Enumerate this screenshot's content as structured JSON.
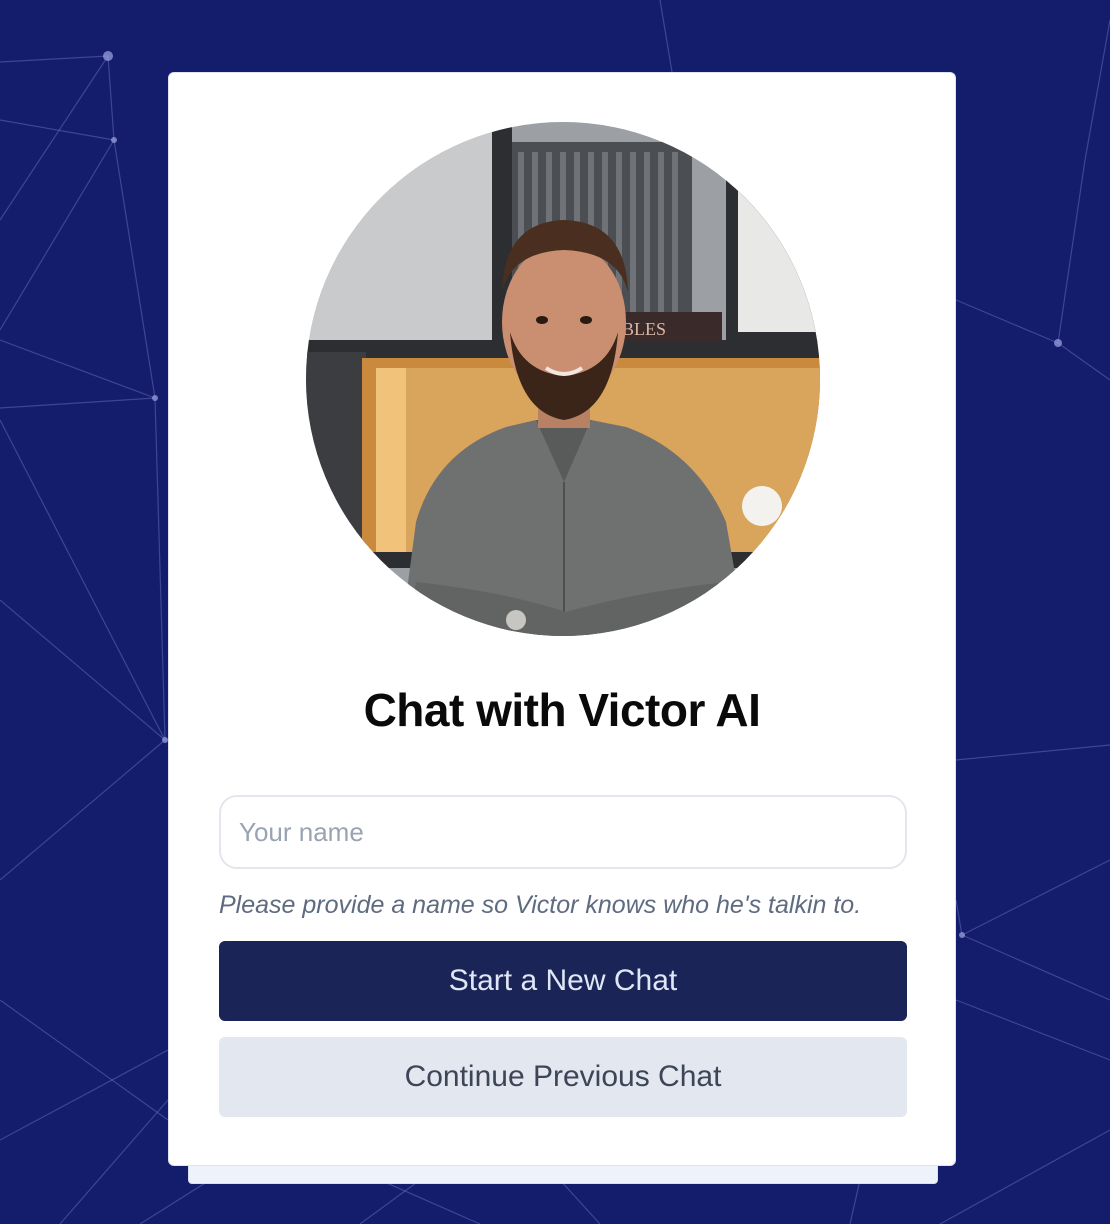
{
  "card": {
    "title": "Chat with Victor AI",
    "name_input": {
      "placeholder": "Your name",
      "value": ""
    },
    "hint": "Please provide a name so Victor knows who he's talkin to.",
    "start_button_label": "Start a New Chat",
    "continue_button_label": "Continue Previous Chat"
  },
  "avatar": {
    "alt": "Victor portrait",
    "shelf_sign_text": "BLES"
  },
  "colors": {
    "background": "#141c6c",
    "card": "#ffffff",
    "primary_button": "#1b2456",
    "secondary_button": "#e2e7f0"
  }
}
